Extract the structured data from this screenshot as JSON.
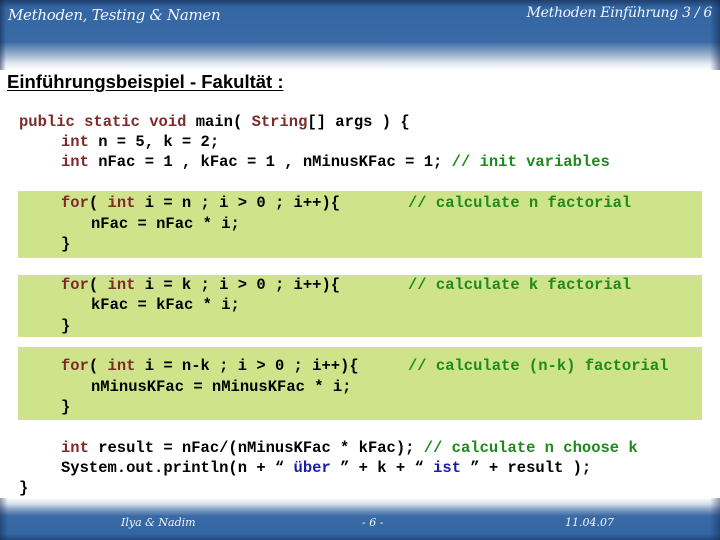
{
  "header": {
    "presentation_title": "Methoden, Testing & Namen",
    "section_label": "Methoden Einführung 3 / 6"
  },
  "slide": {
    "title": "Einführungsbeispiel - Fakultät :"
  },
  "code": {
    "line1": {
      "kw1": "public static void",
      "rest1": " main( ",
      "kw2": "String",
      "rest2": "[] args ) {"
    },
    "line2": {
      "kw": "int",
      "rest": " n = 5, k = 2;"
    },
    "line3": {
      "kw": "int",
      "rest": " nFac = 1 , kFac = 1 , nMinusKFac = 1; ",
      "comment": "// init variables"
    },
    "loop1": {
      "kw1": "for",
      "a": "( ",
      "kw2": "int",
      "b": " i = n ; i > 0 ; i++){",
      "comment": "// calculate n factorial",
      "body": "nFac = nFac * i;",
      "close": "}"
    },
    "loop2": {
      "kw1": "for",
      "a": "( ",
      "kw2": "int",
      "b": " i = k ; i > 0 ; i++){",
      "comment": "// calculate k factorial",
      "body": "kFac = kFac * i;",
      "close": "}"
    },
    "loop3": {
      "kw1": "for",
      "a": "( ",
      "kw2": "int",
      "b": " i = n-k ; i > 0 ; i++){",
      "comment": "// calculate (n-k) factorial",
      "body": "nMinusKFac = nMinusKFac * i;",
      "close": "}"
    },
    "result_line": {
      "kw": "int",
      "rest": " result = nFac/(nMinusKFac * kFac); ",
      "comment": "// calculate n choose k"
    },
    "print_line": {
      "a": "System.out.println(n + “ ",
      "s1": "über",
      "b": " ” + k + “ ",
      "s2": "ist",
      "c": " ” + result );"
    },
    "closing": "}"
  },
  "footer": {
    "authors": "Ilya & Nadim",
    "page": "- 6 -",
    "date": "11.04.07"
  },
  "colors": {
    "header_blue": "#3366a3",
    "code_box_green": "#cfe38b",
    "keyword": "#7f2a2a",
    "comment": "#1e8a1e",
    "string": "#1c1caa"
  }
}
